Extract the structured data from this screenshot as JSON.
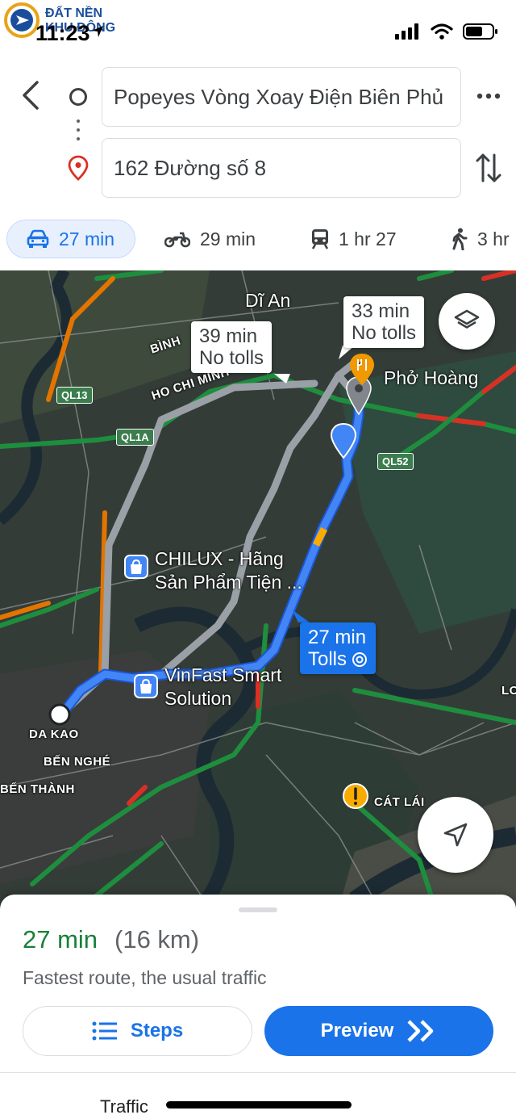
{
  "watermark": {
    "logo_icon": "compass-logo-icon",
    "line1": "ĐẤT NỀN",
    "line2": "KHU ĐÔNG"
  },
  "status_bar": {
    "time": "11:23",
    "icons": [
      "location-arrow-icon",
      "signal-icon",
      "wifi-icon",
      "battery-icon"
    ]
  },
  "route": {
    "origin": "Popeyes Vòng Xoay Điện Biên Phủ",
    "destination": "162 Đường số 8"
  },
  "modes": [
    {
      "icon": "car-icon",
      "label": "27 min",
      "selected": true
    },
    {
      "icon": "motorbike-icon",
      "label": "29 min"
    },
    {
      "icon": "train-icon",
      "label": "1 hr 27"
    },
    {
      "icon": "walk-icon",
      "label": "3 hr"
    }
  ],
  "map": {
    "place_labels": {
      "di_an": "Dĩ An",
      "binh": "BÌNH",
      "hcm": "HO CHI MINH",
      "pho_hoang": "Phở Hoàng",
      "chilux_1": "CHILUX - Hãng",
      "chilux_2": "Sản Phẩm Tiện ...",
      "vinfast_1": "VinFast Smart",
      "vinfast_2": "Solution",
      "da_kao": "DA KAO",
      "ben_nghe": "BẾN NGHÉ",
      "ben_thanh": "BẾN THÀNH",
      "cat_lai": "CÁT LÁI",
      "lo": "LO"
    },
    "road_badges": {
      "ql13": "QL13",
      "ql1a": "QL1A",
      "ql52": "QL52"
    },
    "callouts": {
      "alt1_time": "39 min",
      "alt1_note": "No tolls",
      "alt2_time": "33 min",
      "alt2_note": "No tolls",
      "main_time": "27 min",
      "main_note": "Tolls"
    },
    "route_color": "#4285f4",
    "alt_route_color": "#9aa0a6"
  },
  "summary": {
    "time": "27 min",
    "distance": "(16 km)",
    "note": "Fastest route, the usual traffic",
    "steps_label": "Steps",
    "preview_label": "Preview",
    "traffic_label": "Traffic"
  },
  "colors": {
    "accent": "#1a73e8",
    "time_green": "#188038"
  }
}
